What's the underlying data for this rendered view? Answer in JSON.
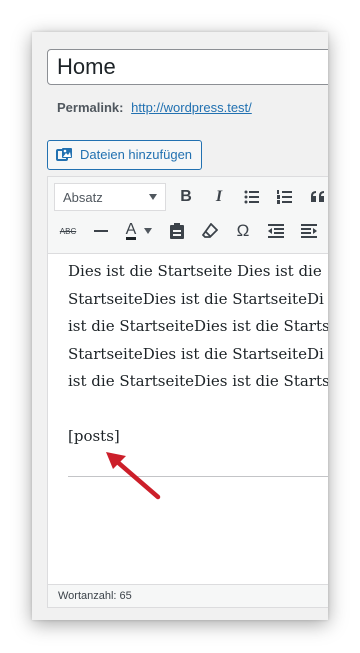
{
  "title_field": {
    "value": "Home"
  },
  "permalink": {
    "label": "Permalink:",
    "url": "http://wordpress.test/"
  },
  "media_button": {
    "label": "Dateien hinzufügen"
  },
  "toolbar": {
    "format_select": "Absatz",
    "buttons_row1": [
      "bold-icon",
      "italic-icon",
      "bullet-list-icon",
      "numbered-list-icon",
      "blockquote-icon"
    ],
    "buttons_row2": [
      "strikethrough-icon",
      "horizontal-line-icon",
      "text-color-icon",
      "paste-text-icon",
      "clear-formatting-icon",
      "special-character-icon",
      "outdent-icon",
      "indent-icon"
    ],
    "strikethrough_label": "ABC",
    "text_color_label": "A",
    "omega_label": "Ω"
  },
  "content": {
    "lines": [
      "Dies ist die Startseite Dies ist die",
      "StartseiteDies ist die StartseiteDi",
      "ist die StartseiteDies ist die Starts",
      "StartseiteDies ist die StartseiteDi",
      "ist die StartseiteDies ist die Starts"
    ],
    "shortcode": "[posts]"
  },
  "status": {
    "word_count": "Wortanzahl: 65"
  },
  "colors": {
    "accent": "#2271b1",
    "arrow": "#cc1f2a"
  }
}
